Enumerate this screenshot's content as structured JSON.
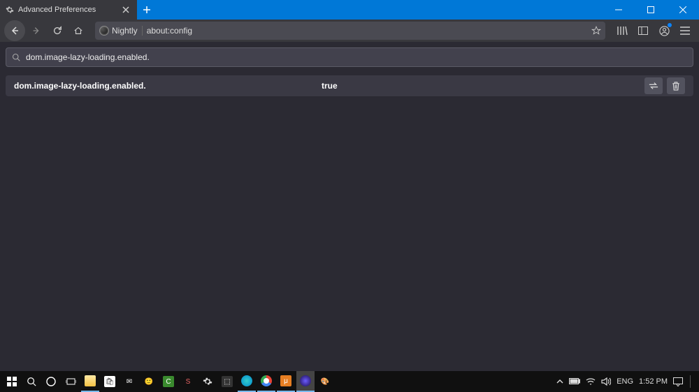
{
  "titlebar": {
    "tab_title": "Advanced Preferences"
  },
  "toolbar": {
    "identity_label": "Nightly",
    "url": "about:config"
  },
  "config": {
    "search_value": "dom.image-lazy-loading.enabled.",
    "pref_name": "dom.image-lazy-loading.enabled.",
    "pref_value": "true"
  },
  "taskbar": {
    "lang": "ENG",
    "time": "1:52 PM"
  }
}
